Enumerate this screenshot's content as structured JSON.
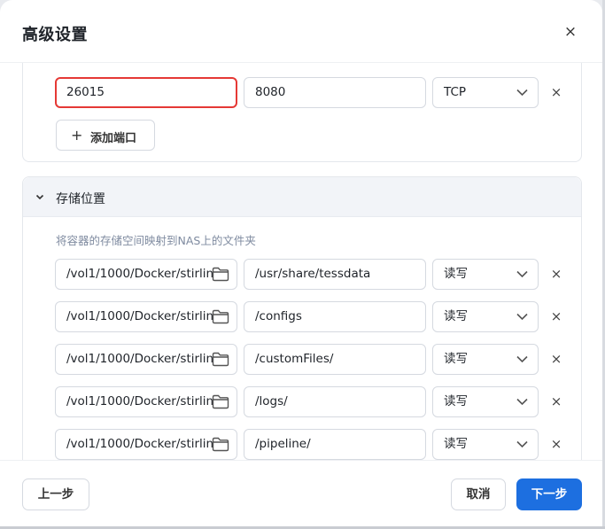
{
  "dialog": {
    "title": "高级设置",
    "close_label": "×"
  },
  "ports": {
    "host_port": "26015",
    "container_port": "8080",
    "protocol": "TCP",
    "remove_label": "×",
    "add_label": "添加端口",
    "add_icon": "+"
  },
  "storage": {
    "title": "存储位置",
    "hint": "将容器的存储空间映射到NAS上的文件夹",
    "rows": [
      {
        "host": "/vol1/1000/Docker/stirlin",
        "container": "/usr/share/tessdata",
        "mode": "读写",
        "remove": "×"
      },
      {
        "host": "/vol1/1000/Docker/stirlin",
        "container": "/configs",
        "mode": "读写",
        "remove": "×"
      },
      {
        "host": "/vol1/1000/Docker/stirlin",
        "container": "/customFiles/",
        "mode": "读写",
        "remove": "×"
      },
      {
        "host": "/vol1/1000/Docker/stirlin",
        "container": "/logs/",
        "mode": "读写",
        "remove": "×"
      },
      {
        "host": "/vol1/1000/Docker/stirlin",
        "container": "/pipeline/",
        "mode": "读写",
        "remove": "×"
      }
    ]
  },
  "footer": {
    "prev_label": "上一步",
    "cancel_label": "取消",
    "next_label": "下一步"
  },
  "colors": {
    "primary": "#1d6fe0",
    "highlight_border": "#e53935",
    "hint_text": "#7f8ba0"
  }
}
